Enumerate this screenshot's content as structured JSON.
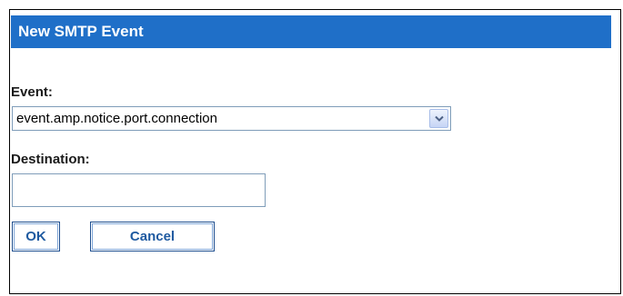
{
  "dialog": {
    "title": "New SMTP Event",
    "event_label": "Event:",
    "event_selected": "event.amp.notice.port.connection",
    "destination_label": "Destination:",
    "destination_value": "",
    "ok_label": "OK",
    "cancel_label": "Cancel"
  },
  "colors": {
    "header_bg": "#1f6fc8",
    "button_text": "#1f5aa0"
  },
  "icons": {
    "dropdown": "chevron-down-icon"
  }
}
